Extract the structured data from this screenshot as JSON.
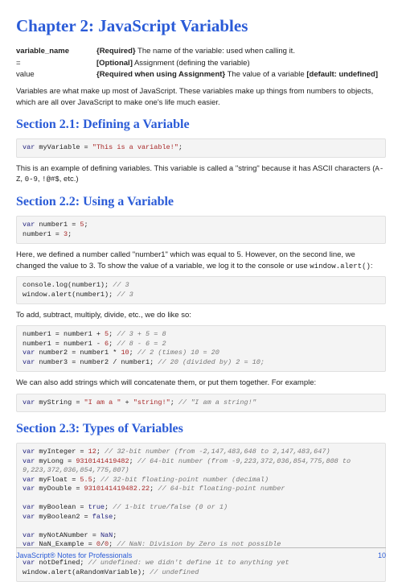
{
  "chapter_title": "Chapter 2: JavaScript Variables",
  "params": [
    {
      "name": "variable_name",
      "desc_html": "<b>{Required}</b> The name of the variable: used when calling it.",
      "bold_name": true
    },
    {
      "name": "=",
      "desc_html": "<b>[Optional]</b> Assignment (defining the variable)",
      "bold_name": false
    },
    {
      "name": "value",
      "desc_html": "<b>{Required when using Assignment}</b> The value of a variable <b>[default: undefined]</b>",
      "bold_name": false
    }
  ],
  "intro_para": "Variables are what make up most of JavaScript. These variables make up things from numbers to objects, which are all over JavaScript to make one's life much easier.",
  "section_21": {
    "title": "Section 2.1: Defining a Variable",
    "code": "<span class=\"kw\">var</span> myVariable = <span class=\"num\">\"This is a variable!\"</span>;",
    "para_html": "This is an example of defining variables. This variable is called a \"string\" because it has ASCII characters (<code class=\"inline\">A-Z</code>, <code class=\"inline\">0-9</code>, <code class=\"inline\">!@#$</code>, etc.)"
  },
  "section_22": {
    "title": "Section 2.2: Using a Variable",
    "code1": "<span class=\"kw\">var</span> number1 = <span class=\"num\">5</span>;\nnumber1 = <span class=\"num\">3</span>;",
    "para1_html": "Here, we defined a number called \"number1\" which was equal to 5. However, on the second line, we changed the value to 3. To show the value of a variable, we log it to the console or use <code class=\"inline\">window.alert()</code>:",
    "code2": "console.log(number1); <span class=\"cm\">// 3</span>\nwindow.alert(number1); <span class=\"cm\">// 3</span>",
    "para2": "To add, subtract, multiply, divide, etc., we do like so:",
    "code3": "number1 = number1 + <span class=\"num\">5</span>; <span class=\"cm\">// 3 + 5 = 8</span>\nnumber1 = number1 - <span class=\"num\">6</span>; <span class=\"cm\">// 8 - 6 = 2</span>\n<span class=\"kw\">var</span> number2 = number1 * <span class=\"num\">10</span>; <span class=\"cm\">// 2 (times) 10 = 20</span>\n<span class=\"kw\">var</span> number3 = number2 / number1; <span class=\"cm\">// 20 (divided by) 2 = 10;</span>",
    "para3": "We can also add strings which will concatenate them, or put them together. For example:",
    "code4": "<span class=\"kw\">var</span> myString = <span class=\"num\">\"I am a \"</span> + <span class=\"num\">\"string!\"</span>; <span class=\"cm\">// \"I am a string!\"</span>"
  },
  "section_23": {
    "title": "Section 2.3: Types of Variables",
    "code": "<span class=\"kw\">var</span> myInteger = <span class=\"num\">12</span>; <span class=\"cm\">// 32-bit number (from -2,147,483,648 to 2,147,483,647)</span>\n<span class=\"kw\">var</span> myLong = <span class=\"num\">9310141419482</span>; <span class=\"cm\">// 64-bit number (from -9,223,372,036,854,775,808 to\n9,223,372,036,854,775,807)</span>\n<span class=\"kw\">var</span> myFloat = <span class=\"num\">5.5</span>; <span class=\"cm\">// 32-bit floating-point number (decimal)</span>\n<span class=\"kw\">var</span> myDouble = <span class=\"num\">9310141419482.22</span>; <span class=\"cm\">// 64-bit floating-point number</span>\n\n<span class=\"kw\">var</span> myBoolean = <span class=\"kw\">true</span>; <span class=\"cm\">// 1-bit true/false (0 or 1)</span>\n<span class=\"kw\">var</span> myBoolean2 = <span class=\"kw\">false</span>;\n\n<span class=\"kw\">var</span> myNotANumber = <span class=\"kw\">NaN</span>;\n<span class=\"kw\">var</span> NaN_Example = <span class=\"num\">0</span>/<span class=\"num\">0</span>; <span class=\"cm\">// NaN: Division by Zero is not possible</span>\n\n<span class=\"kw\">var</span> notDefined; <span class=\"cm\">// undefined: we didn't define it to anything yet</span>\nwindow.alert(aRandomVariable); <span class=\"cm\">// undefined</span>"
  },
  "footer": {
    "left": "JavaScript® Notes for Professionals",
    "right": "10"
  }
}
